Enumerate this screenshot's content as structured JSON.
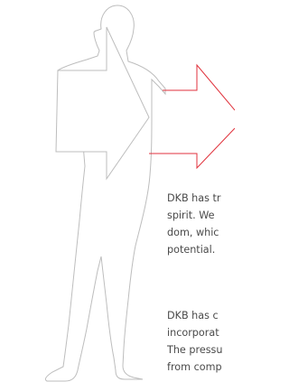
{
  "paragraphs": [
    [
      "DKB has tr",
      "spirit. We",
      "dom, whic",
      "potential."
    ],
    [
      "DKB has c",
      "incorporat",
      "The pressu",
      "from comp"
    ]
  ],
  "colors": {
    "figure_outline": "#bdbdbd",
    "arrow_outline": "#e0323c",
    "text": "#4a4a4a",
    "background": "#ffffff"
  }
}
